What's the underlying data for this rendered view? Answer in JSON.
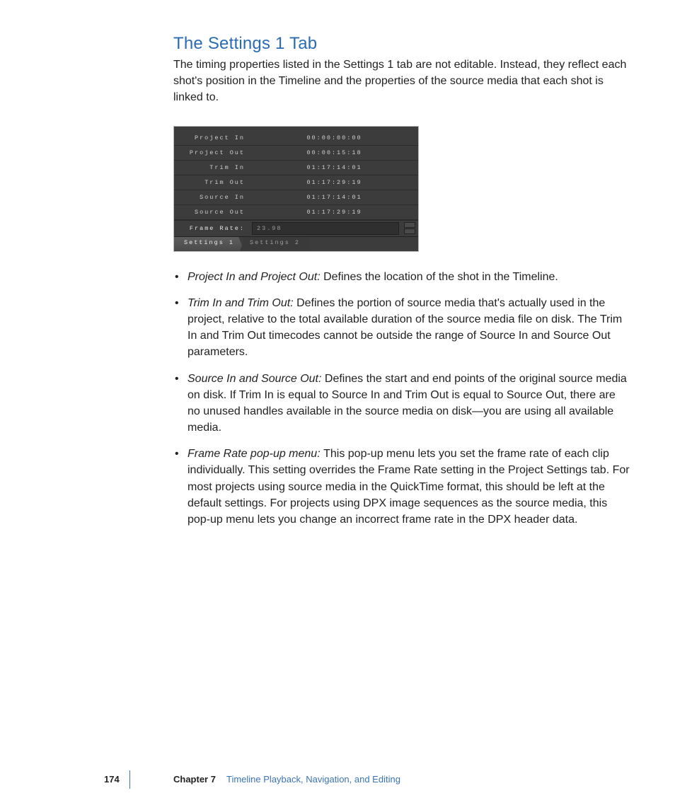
{
  "heading": "The Settings 1 Tab",
  "intro": "The timing properties listed in the Settings 1 tab are not editable. Instead, they reflect each shot's position in the Timeline and the properties of the source media that each shot is linked to.",
  "panel": {
    "rows": [
      {
        "label": "Project In",
        "value": "00:00:00:00"
      },
      {
        "label": "Project Out",
        "value": "00:00:15:18"
      },
      {
        "label": "Trim In",
        "value": "01:17:14:01"
      },
      {
        "label": "Trim Out",
        "value": "01:17:29:19"
      },
      {
        "label": "Source In",
        "value": "01:17:14:01"
      },
      {
        "label": "Source Out",
        "value": "01:17:29:19"
      }
    ],
    "frame_rate": {
      "label": "Frame Rate:",
      "value": "23.98"
    },
    "tabs": [
      {
        "label": "Settings 1",
        "active": true
      },
      {
        "label": "Settings 2",
        "active": false
      }
    ]
  },
  "definitions": [
    {
      "term": "Project In and Project Out:  ",
      "desc": "Defines the location of the shot in the Timeline."
    },
    {
      "term": "Trim In and Trim Out:  ",
      "desc": "Defines the portion of source media that's actually used in the project, relative to the total available duration of the source media file on disk. The Trim In and Trim Out timecodes cannot be outside the range of Source In and Source Out parameters."
    },
    {
      "term": "Source In and Source Out:  ",
      "desc": "Defines the start and end points of the original source media on disk. If Trim In is equal to Source In and Trim Out is equal to Source Out, there are no unused handles available in the source media on disk—you are using all available media."
    },
    {
      "term": "Frame Rate pop-up menu:  ",
      "desc": "This pop-up menu lets you set the frame rate of each clip individually. This setting overrides the Frame Rate setting in the Project Settings tab. For most projects using source media in the QuickTime format, this should be left at the default settings. For projects using DPX image sequences as the source media, this pop-up menu lets you change an incorrect frame rate in the DPX header data."
    }
  ],
  "footer": {
    "page_number": "174",
    "chapter_label": "Chapter 7",
    "chapter_title": "Timeline Playback, Navigation, and Editing"
  }
}
